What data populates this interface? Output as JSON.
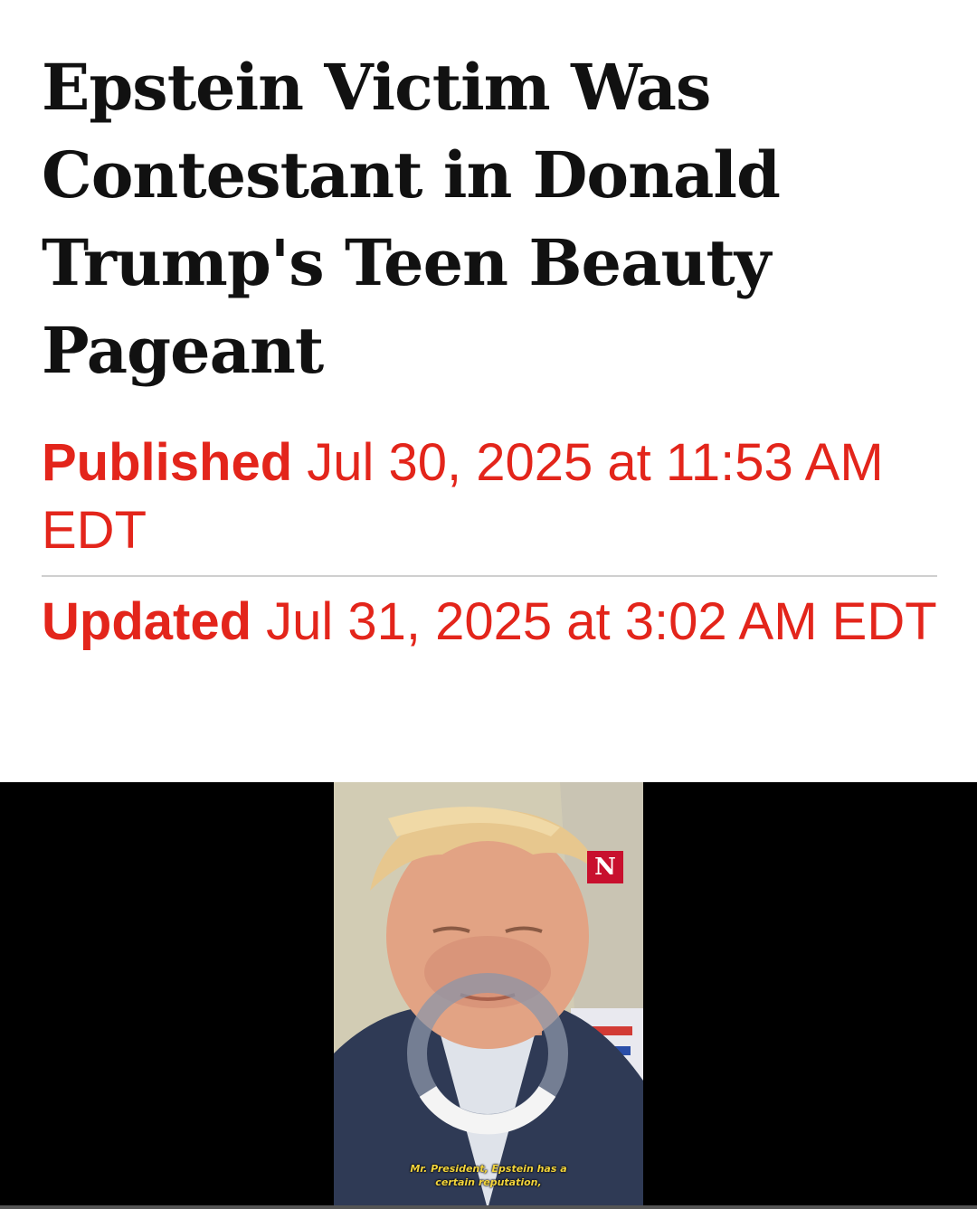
{
  "article": {
    "headline": "Epstein Victim Was Contestant in Donald Trump's Teen Beauty Pageant",
    "published": {
      "label": "Published",
      "value": "Jul 30, 2025 at 11:53 AM EDT"
    },
    "updated": {
      "label": "Updated",
      "value": "Jul 31, 2025 at 3:02 AM EDT"
    }
  },
  "video": {
    "brand_badge": "N",
    "caption_line_1": "Mr. President, Epstein has a",
    "caption_line_2": "certain reputation,",
    "state": "loading",
    "loading_icon": "spinner-icon"
  },
  "colors": {
    "accent": "#e3251b",
    "headline": "#111111",
    "video_background": "#000000"
  }
}
